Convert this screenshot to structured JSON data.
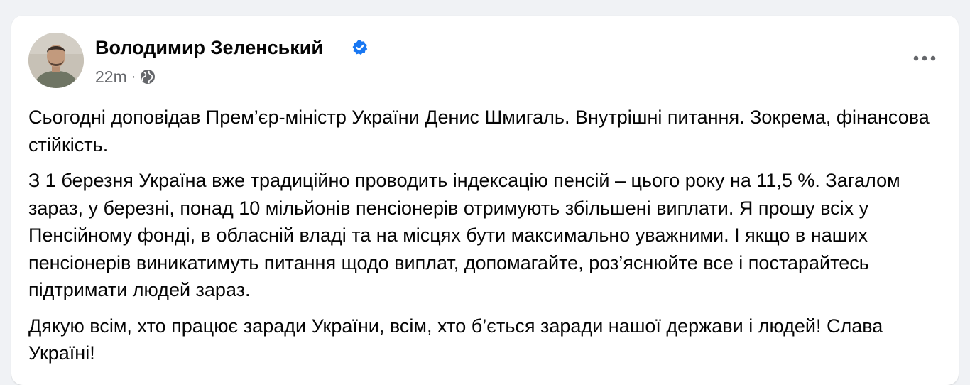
{
  "post": {
    "author_name": "Володимир Зеленський",
    "verified": true,
    "time": "22m",
    "separator": "·",
    "audience_icon": "globe-icon",
    "more_icon": "more-options-icon",
    "paragraphs": [
      "Сьогодні доповідав Прем’єр-міністр України Денис Шмигаль. Внутрішні питання. Зокрема, фінансова стійкість.",
      "З 1 березня Україна вже традиційно проводить індексацію пенсій – цього року на 11,5 %. Загалом зараз, у березні, понад 10 мільйонів пенсіонерів отримують збільшені виплати. Я прошу всіх у Пенсійному фонді, в обласній владі та на місцях бути максимально уважними. І якщо в наших пенсіонерів виникатимуть питання щодо виплат, допомагайте, роз’яснюйте все і постарайтесь підтримати людей зараз.",
      "Дякую всім, хто працює заради України, всім, хто б’ється заради нашої держави і людей! Слава Україні!"
    ]
  },
  "colors": {
    "page_background": "#f0f2f5",
    "card_background": "#ffffff",
    "text_primary": "#050505",
    "text_secondary": "#65676b",
    "verified_blue": "#1877f2"
  }
}
